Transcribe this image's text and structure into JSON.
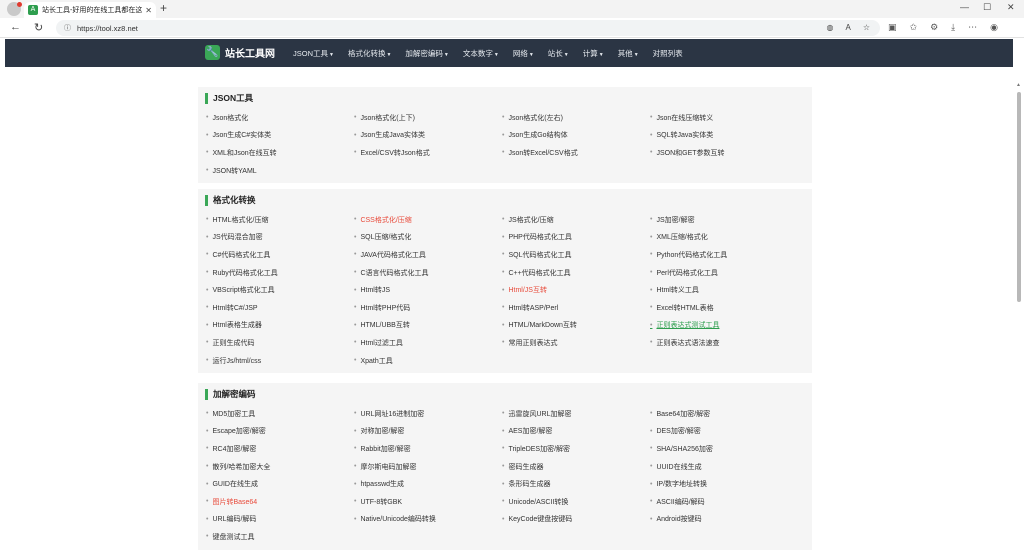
{
  "browser": {
    "tab_title": "站长工具-好用的在线工具都在这",
    "tab_favicon": "A",
    "url": "https://tool.xz8.net",
    "icons": {
      "new_tab": "+",
      "back": "←",
      "refresh": "↻",
      "lock": "ⓘ",
      "minimize": "—",
      "maximize": "☐",
      "close": "✕"
    }
  },
  "site": {
    "logo_glyph": "🔧",
    "name": "站长工具网",
    "menu": [
      "JSON工具",
      "格式化转换",
      "加解密编码",
      "文本数字",
      "网络",
      "站长",
      "计算",
      "其他",
      "对照列表"
    ]
  },
  "sections": [
    {
      "title": "JSON工具",
      "items": [
        {
          "label": "Json格式化"
        },
        {
          "label": "Json格式化(上下)"
        },
        {
          "label": "Json格式化(左右)"
        },
        {
          "label": "Json在线压缩转义"
        },
        {
          "label": "Json生成C#实体类"
        },
        {
          "label": "Json生成Java实体类"
        },
        {
          "label": "Json生成Go结构体"
        },
        {
          "label": "SQL转Java实体类"
        },
        {
          "label": "XML和Json在线互转"
        },
        {
          "label": "Excel/CSV转Json格式"
        },
        {
          "label": "Json转Excel/CSV格式"
        },
        {
          "label": "JSON和GET参数互转"
        },
        {
          "label": "JSON转YAML"
        }
      ]
    },
    {
      "title": "格式化转换",
      "items": [
        {
          "label": "HTML格式化/压缩"
        },
        {
          "label": "CSS格式化/压缩",
          "style": "red"
        },
        {
          "label": "JS格式化/压缩"
        },
        {
          "label": "JS加密/解密"
        },
        {
          "label": "JS代码混合加密"
        },
        {
          "label": "SQL压缩/格式化"
        },
        {
          "label": "PHP代码格式化工具"
        },
        {
          "label": "XML压缩/格式化"
        },
        {
          "label": "C#代码格式化工具"
        },
        {
          "label": "JAVA代码格式化工具"
        },
        {
          "label": "SQL代码格式化工具"
        },
        {
          "label": "Python代码格式化工具"
        },
        {
          "label": "Ruby代码格式化工具"
        },
        {
          "label": "C语言代码格式化工具"
        },
        {
          "label": "C++代码格式化工具"
        },
        {
          "label": "Perl代码格式化工具"
        },
        {
          "label": "VBScript格式化工具"
        },
        {
          "label": "Html转JS"
        },
        {
          "label": "Html/JS互转",
          "style": "red"
        },
        {
          "label": "Html转义工具"
        },
        {
          "label": "Html转C#/JSP"
        },
        {
          "label": "Html转PHP代码"
        },
        {
          "label": "Html转ASP/Perl"
        },
        {
          "label": "Excel转HTML表格"
        },
        {
          "label": "Html表格生成器"
        },
        {
          "label": "HTML/UBB互转"
        },
        {
          "label": "HTML/MarkDown互转"
        },
        {
          "label": "正则表达式测试工具",
          "style": "green"
        },
        {
          "label": "正则生成代码"
        },
        {
          "label": "Html过滤工具"
        },
        {
          "label": "常用正则表达式"
        },
        {
          "label": "正则表达式语法速查"
        },
        {
          "label": "运行Js/html/css"
        },
        {
          "label": "Xpath工具"
        }
      ]
    },
    {
      "title": "加解密编码",
      "items": [
        {
          "label": "MD5加密工具"
        },
        {
          "label": "URL网址16进制加密"
        },
        {
          "label": "迅雷旋风URL加解密"
        },
        {
          "label": "Base64加密/解密"
        },
        {
          "label": "Escape加密/解密"
        },
        {
          "label": "对称加密/解密"
        },
        {
          "label": "AES加密/解密"
        },
        {
          "label": "DES加密/解密"
        },
        {
          "label": "RC4加密/解密"
        },
        {
          "label": "Rabbit加密/解密"
        },
        {
          "label": "TripleDES加密/解密"
        },
        {
          "label": "SHA/SHA256加密"
        },
        {
          "label": "散列/哈希加密大全"
        },
        {
          "label": "摩尔斯电码加解密"
        },
        {
          "label": "密码生成器"
        },
        {
          "label": "UUID在线生成"
        },
        {
          "label": "GUID在线生成"
        },
        {
          "label": "htpasswd生成"
        },
        {
          "label": "条形码生成器"
        },
        {
          "label": "IP/数字地址转换"
        },
        {
          "label": "图片转Base64",
          "style": "red"
        },
        {
          "label": "UTF-8转GBK"
        },
        {
          "label": "Unicode/ASCII转换"
        },
        {
          "label": "ASCII编码/解码"
        },
        {
          "label": "URL编码/解码"
        },
        {
          "label": "Native/Unicode编码转换"
        },
        {
          "label": "KeyCode键盘按键码"
        },
        {
          "label": "Android按键码"
        },
        {
          "label": "键盘测试工具"
        }
      ]
    }
  ]
}
